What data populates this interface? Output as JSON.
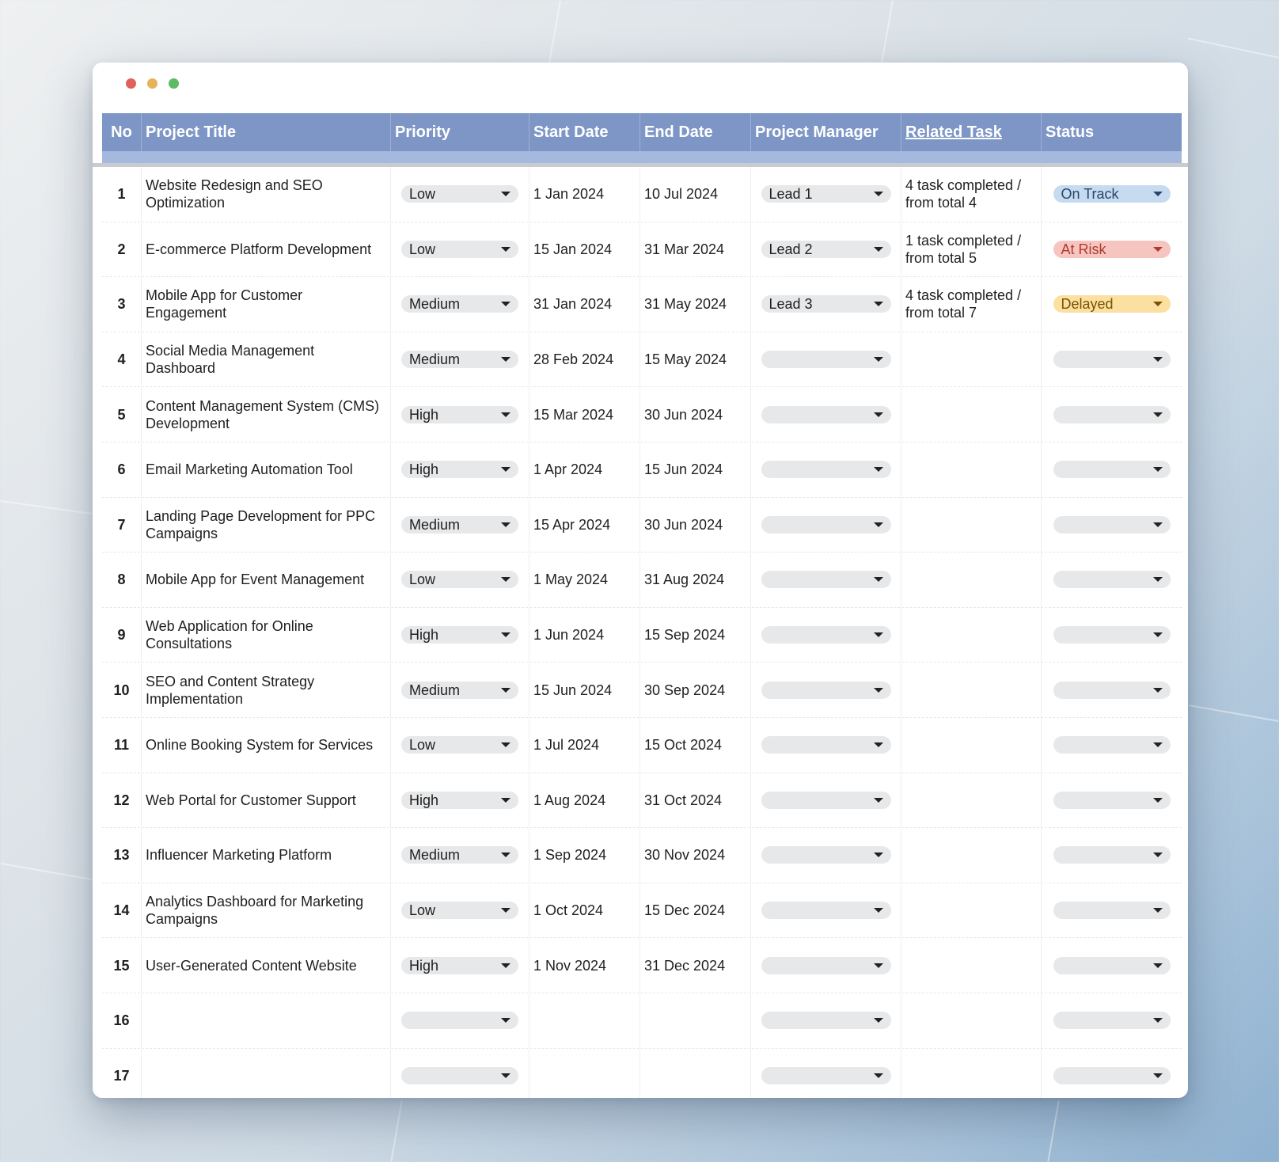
{
  "columns": [
    "No",
    "Project Title",
    "Priority",
    "Start Date",
    "End Date",
    "Project Manager",
    "Related Task",
    "Status"
  ],
  "rows": [
    {
      "no": "1",
      "title": "Website Redesign and SEO Optimization",
      "priority": "Low",
      "start": "1 Jan 2024",
      "end": "10 Jul 2024",
      "manager": "Lead 1",
      "task": "4 task completed / from total 4",
      "status": "On Track"
    },
    {
      "no": "2",
      "title": "E-commerce Platform Development",
      "priority": "Low",
      "start": "15 Jan 2024",
      "end": "31 Mar 2024",
      "manager": "Lead 2",
      "task": "1 task completed / from total 5",
      "status": "At Risk"
    },
    {
      "no": "3",
      "title": "Mobile App for Customer Engagement",
      "priority": "Medium",
      "start": "31 Jan 2024",
      "end": "31 May 2024",
      "manager": "Lead 3",
      "task": "4 task completed / from total 7",
      "status": "Delayed"
    },
    {
      "no": "4",
      "title": "Social Media Management Dashboard",
      "priority": "Medium",
      "start": "28 Feb 2024",
      "end": "15 May 2024",
      "manager": "",
      "task": "",
      "status": ""
    },
    {
      "no": "5",
      "title": "Content Management System (CMS) Development",
      "priority": "High",
      "start": "15 Mar 2024",
      "end": "30 Jun 2024",
      "manager": "",
      "task": "",
      "status": ""
    },
    {
      "no": "6",
      "title": "Email Marketing Automation Tool",
      "priority": "High",
      "start": "1 Apr 2024",
      "end": "15 Jun 2024",
      "manager": "",
      "task": "",
      "status": ""
    },
    {
      "no": "7",
      "title": "Landing Page Development for PPC Campaigns",
      "priority": "Medium",
      "start": "15 Apr 2024",
      "end": "30 Jun 2024",
      "manager": "",
      "task": "",
      "status": ""
    },
    {
      "no": "8",
      "title": "Mobile App for Event Management",
      "priority": "Low",
      "start": "1 May 2024",
      "end": "31 Aug 2024",
      "manager": "",
      "task": "",
      "status": ""
    },
    {
      "no": "9",
      "title": "Web Application for Online Consultations",
      "priority": "High",
      "start": "1 Jun 2024",
      "end": "15 Sep 2024",
      "manager": "",
      "task": "",
      "status": ""
    },
    {
      "no": "10",
      "title": "SEO and Content Strategy Implementation",
      "priority": "Medium",
      "start": "15 Jun 2024",
      "end": "30 Sep 2024",
      "manager": "",
      "task": "",
      "status": ""
    },
    {
      "no": "11",
      "title": "Online Booking System for Services",
      "priority": "Low",
      "start": "1 Jul 2024",
      "end": "15 Oct 2024",
      "manager": "",
      "task": "",
      "status": ""
    },
    {
      "no": "12",
      "title": "Web Portal for Customer Support",
      "priority": "High",
      "start": "1 Aug 2024",
      "end": "31 Oct 2024",
      "manager": "",
      "task": "",
      "status": ""
    },
    {
      "no": "13",
      "title": "Influencer Marketing Platform",
      "priority": "Medium",
      "start": "1 Sep 2024",
      "end": "30 Nov 2024",
      "manager": "",
      "task": "",
      "status": ""
    },
    {
      "no": "14",
      "title": "Analytics Dashboard for Marketing Campaigns",
      "priority": "Low",
      "start": "1 Oct 2024",
      "end": "15 Dec 2024",
      "manager": "",
      "task": "",
      "status": ""
    },
    {
      "no": "15",
      "title": "User-Generated Content Website",
      "priority": "High",
      "start": "1 Nov 2024",
      "end": "31 Dec 2024",
      "manager": "",
      "task": "",
      "status": ""
    },
    {
      "no": "16",
      "title": "",
      "priority": "",
      "start": "",
      "end": "",
      "manager": "",
      "task": "",
      "status": ""
    },
    {
      "no": "17",
      "title": "",
      "priority": "",
      "start": "",
      "end": "",
      "manager": "",
      "task": "",
      "status": ""
    }
  ],
  "colors": {
    "header_bg": "#7d96c6",
    "header_strip": "#a4b9dd",
    "chip_bg": "#e7e8ea",
    "status_on_track": "#c6dbf0",
    "status_at_risk": "#f7c5c0",
    "status_delayed": "#fbe0a1"
  },
  "icons": {
    "window_controls": [
      "close-dot",
      "minimize-dot",
      "maximize-dot"
    ],
    "dropdown": "caret-down-icon"
  }
}
